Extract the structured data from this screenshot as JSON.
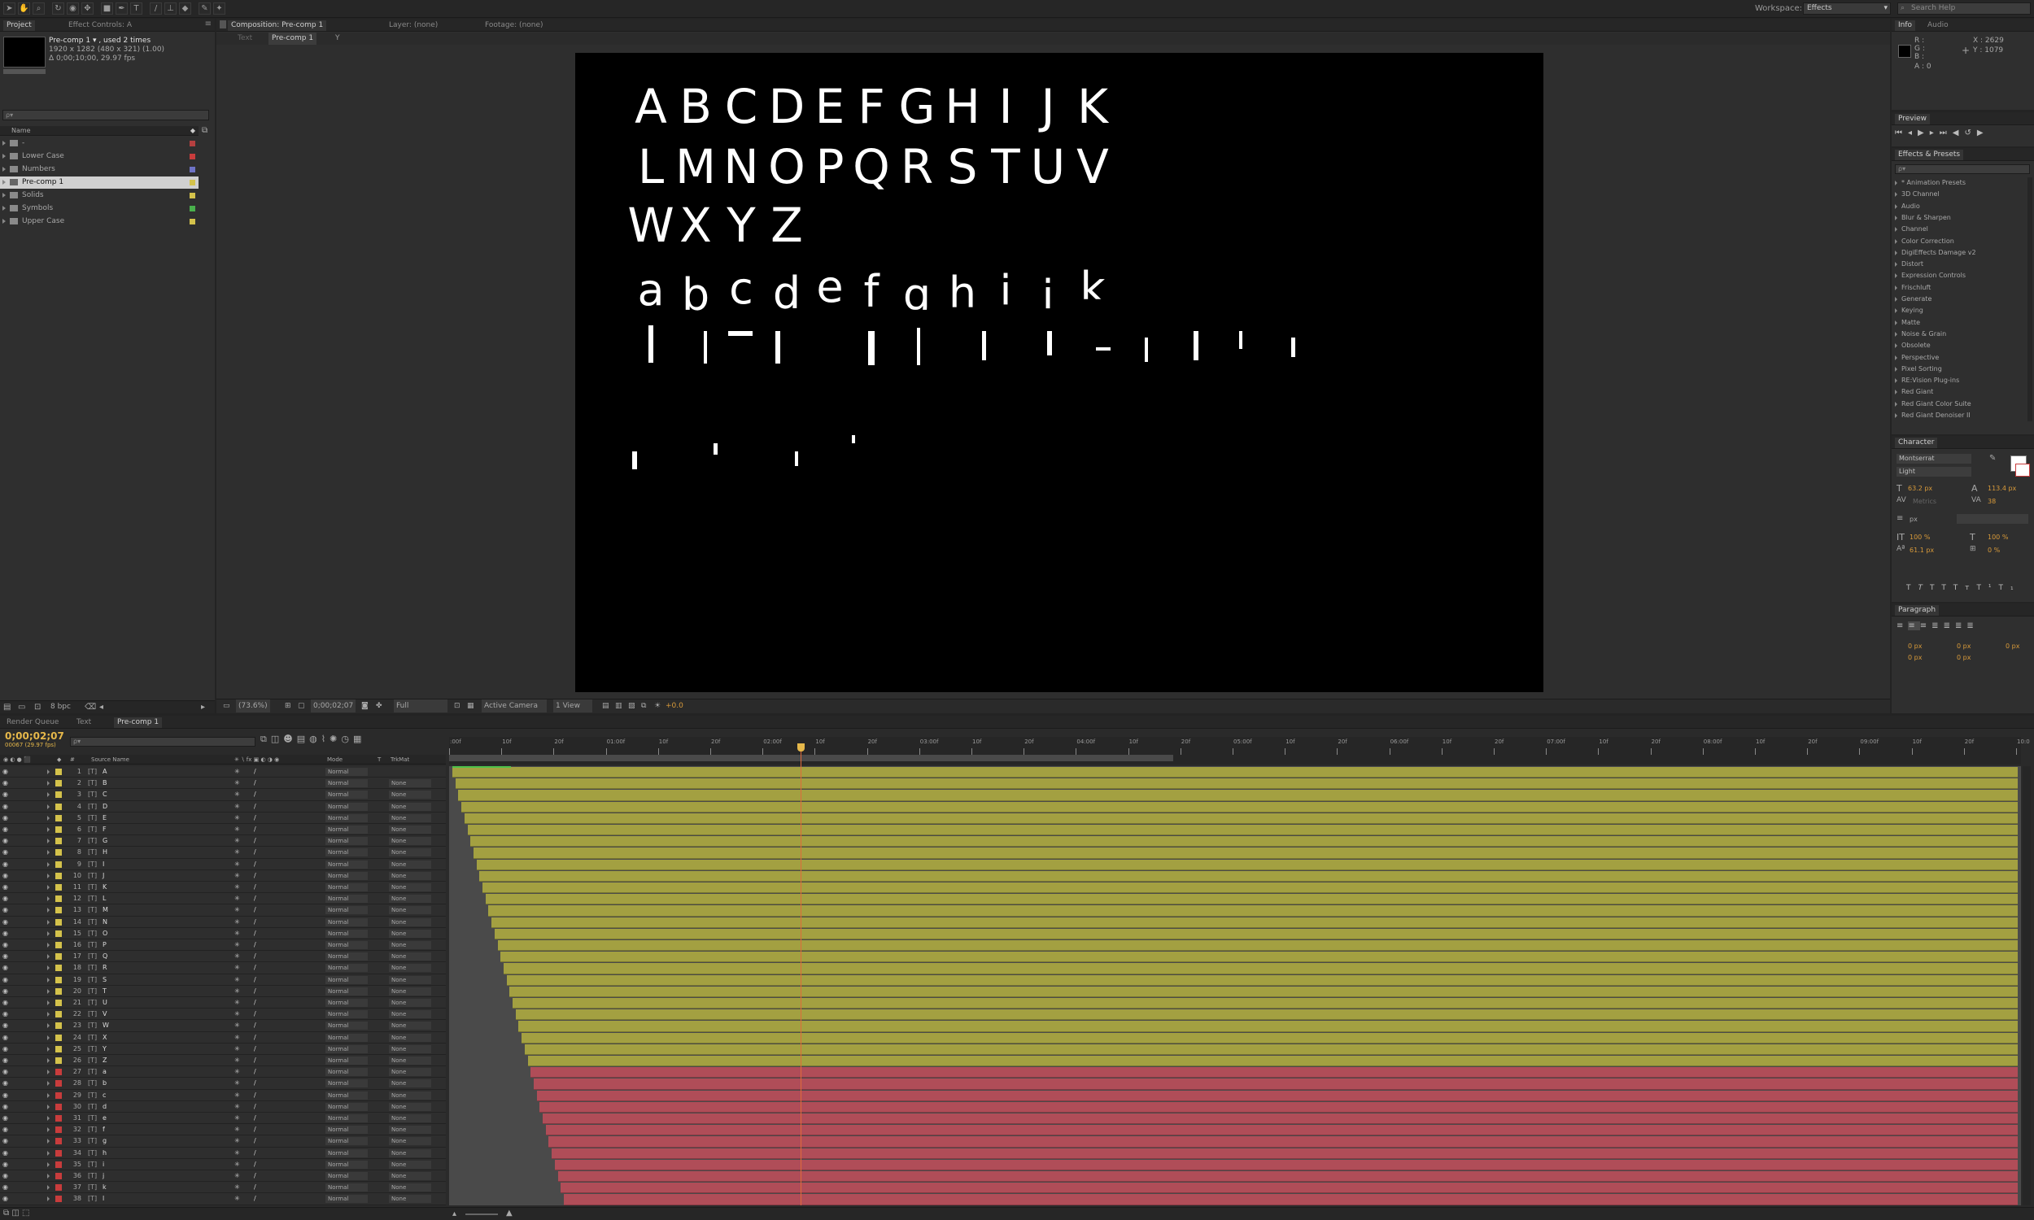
{
  "toolbar": {
    "workspace_label": "Workspace:",
    "workspace_value": "Effects",
    "search_placeholder": "Search Help"
  },
  "project_panel": {
    "tabs": [
      "Project",
      "Effect Controls: A"
    ],
    "item_name": "Pre-comp 1 ▾ , used 2 times",
    "item_info1": "1920 x 1282  (480 x 321) (1.00)",
    "item_info2": "Δ 0;00;10;00, 29.97 fps",
    "search_placeholder": "ρ▾",
    "col_name": "Name",
    "items": [
      {
        "label": "-",
        "color": "#b54040"
      },
      {
        "label": "Lower Case",
        "color": "#c83c3c"
      },
      {
        "label": "Numbers",
        "color": "#6e73c6"
      },
      {
        "label": "Pre-comp 1",
        "color": "#d4c24b"
      },
      {
        "label": "Solids",
        "color": "#d4c24b"
      },
      {
        "label": "Symbols",
        "color": "#49b04c"
      },
      {
        "label": "Upper Case",
        "color": "#d4c24b"
      }
    ],
    "bpc": "8 bpc"
  },
  "comp_panel": {
    "tabs": [
      "Composition: Pre-comp 1",
      "Layer: (none)",
      "Footage: (none)"
    ],
    "crumbs": [
      "Text",
      "Pre-comp 1",
      "Y"
    ],
    "zoom": "(73.6%)",
    "timecode": "0;00;02;07",
    "resolution": "Full",
    "camera": "Active Camera",
    "views": "1 View",
    "exposure": "+0.0",
    "upper_rows": [
      [
        "A",
        "B",
        "C",
        "D",
        "E",
        "F",
        "G",
        "H",
        "I",
        "J",
        "K"
      ],
      [
        "L",
        "M",
        "N",
        "O",
        "P",
        "Q",
        "R",
        "S",
        "T",
        "U",
        "V"
      ],
      [
        "W",
        "X",
        "Y",
        "Z"
      ]
    ],
    "lower_row": [
      "a",
      "b",
      "c",
      "d",
      "e",
      "f",
      "g",
      "h",
      "i",
      "j",
      "k"
    ]
  },
  "info_panel": {
    "tabs": [
      "Info",
      "Audio"
    ],
    "r": "R :",
    "g": "G :",
    "b": "B :",
    "a": "A : 0",
    "x": "X : 2629",
    "y": "Y : 1079"
  },
  "preview_panel": {
    "title": "Preview"
  },
  "effects_panel": {
    "title": "Effects & Presets",
    "search_placeholder": "ρ▾",
    "items": [
      "* Animation Presets",
      "3D Channel",
      "Audio",
      "Blur & Sharpen",
      "Channel",
      "Color Correction",
      "DigiEffects Damage v2",
      "Distort",
      "Expression Controls",
      "Frischluft",
      "Generate",
      "Keying",
      "Matte",
      "Noise & Grain",
      "Obsolete",
      "Perspective",
      "Pixel Sorting",
      "RE:Vision Plug-ins",
      "Red Giant",
      "Red Giant Color Suite",
      "Red Giant Denoiser II"
    ]
  },
  "character_panel": {
    "title": "Character",
    "font": "Montserrat",
    "style": "Light",
    "size": "63.2 px",
    "leading": "113.4 px",
    "kerning": "Metrics",
    "tracking": "38",
    "stroke_unit": "px",
    "vscale": "100 %",
    "hscale": "100 %",
    "baseline": "61.1 px",
    "tsume": "0 %"
  },
  "paragraph_panel": {
    "title": "Paragraph",
    "indent_left": "0 px",
    "indent_right": "0 px",
    "indent_first": "0 px",
    "space_before": "0 px",
    "space_after": "0 px"
  },
  "timeline": {
    "tabs": [
      "Render Queue",
      "Text",
      "Pre-comp 1"
    ],
    "timecode": "0;00;02;07",
    "frames": "00067 (29.97 fps)",
    "search_placeholder": "ρ▾",
    "col_num": "#",
    "col_source": "Source Name",
    "col_mode": "Mode",
    "col_t": "T",
    "col_trkmat": "TrkMat",
    "ruler": [
      ":00f",
      "10f",
      "20f",
      "01:00f",
      "10f",
      "20f",
      "02:00f",
      "10f",
      "20f",
      "03:00f",
      "10f",
      "20f",
      "04:00f",
      "10f",
      "20f",
      "05:00f",
      "10f",
      "20f",
      "06:00f",
      "10f",
      "20f",
      "07:00f",
      "10f",
      "20f",
      "08:00f",
      "10f",
      "20f",
      "09:00f",
      "10f",
      "20f",
      "10:0"
    ],
    "layers": [
      {
        "n": "1",
        "name": "A",
        "trk": ""
      },
      {
        "n": "2",
        "name": "B",
        "trk": "None"
      },
      {
        "n": "3",
        "name": "C",
        "trk": "None"
      },
      {
        "n": "4",
        "name": "D",
        "trk": "None"
      },
      {
        "n": "5",
        "name": "E",
        "trk": "None"
      },
      {
        "n": "6",
        "name": "F",
        "trk": "None"
      },
      {
        "n": "7",
        "name": "G",
        "trk": "None"
      },
      {
        "n": "8",
        "name": "H",
        "trk": "None"
      },
      {
        "n": "9",
        "name": "I",
        "trk": "None"
      },
      {
        "n": "10",
        "name": "J",
        "trk": "None"
      },
      {
        "n": "11",
        "name": "K",
        "trk": "None"
      },
      {
        "n": "12",
        "name": "L",
        "trk": "None"
      },
      {
        "n": "13",
        "name": "M",
        "trk": "None"
      },
      {
        "n": "14",
        "name": "N",
        "trk": "None"
      },
      {
        "n": "15",
        "name": "O",
        "trk": "None"
      },
      {
        "n": "16",
        "name": "P",
        "trk": "None"
      },
      {
        "n": "17",
        "name": "Q",
        "trk": "None"
      },
      {
        "n": "18",
        "name": "R",
        "trk": "None"
      },
      {
        "n": "19",
        "name": "S",
        "trk": "None"
      },
      {
        "n": "20",
        "name": "T",
        "trk": "None"
      },
      {
        "n": "21",
        "name": "U",
        "trk": "None"
      },
      {
        "n": "22",
        "name": "V",
        "trk": "None"
      },
      {
        "n": "23",
        "name": "W",
        "trk": "None"
      },
      {
        "n": "24",
        "name": "X",
        "trk": "None"
      },
      {
        "n": "25",
        "name": "Y",
        "trk": "None"
      },
      {
        "n": "26",
        "name": "Z",
        "trk": "None"
      },
      {
        "n": "27",
        "name": "a",
        "trk": "None"
      },
      {
        "n": "28",
        "name": "b",
        "trk": "None"
      },
      {
        "n": "29",
        "name": "c",
        "trk": "None"
      },
      {
        "n": "30",
        "name": "d",
        "trk": "None"
      },
      {
        "n": "31",
        "name": "e",
        "trk": "None"
      },
      {
        "n": "32",
        "name": "f",
        "trk": "None"
      },
      {
        "n": "33",
        "name": "g",
        "trk": "None"
      },
      {
        "n": "34",
        "name": "h",
        "trk": "None"
      },
      {
        "n": "35",
        "name": "i",
        "trk": "None"
      },
      {
        "n": "36",
        "name": "j",
        "trk": "None"
      },
      {
        "n": "37",
        "name": "k",
        "trk": "None"
      },
      {
        "n": "38",
        "name": "l",
        "trk": "None"
      }
    ],
    "mode_value": "Normal",
    "colors": {
      "upper": "#d4c24b",
      "lower": "#c83c3c",
      "bar_upper": "#a3a041",
      "bar_lower": "#b04d58",
      "playhead": "#e06a3a"
    }
  }
}
